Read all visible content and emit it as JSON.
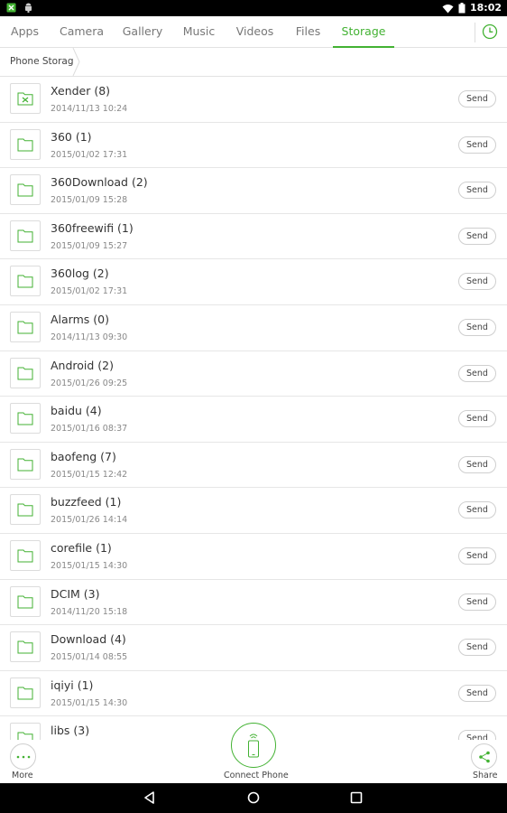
{
  "status_bar": {
    "time": "18:02"
  },
  "tabs": [
    {
      "label": "Apps",
      "active": false
    },
    {
      "label": "Camera",
      "active": false
    },
    {
      "label": "Gallery",
      "active": false
    },
    {
      "label": "Music",
      "active": false
    },
    {
      "label": "Videos",
      "active": false
    },
    {
      "label": "Files",
      "active": false
    },
    {
      "label": "Storage",
      "active": true
    }
  ],
  "breadcrumb": {
    "current": "Phone Storage"
  },
  "files": [
    {
      "name": "Xender (8)",
      "date": "2014/11/13 10:24",
      "icon": "xender-folder-icon"
    },
    {
      "name": "360 (1)",
      "date": "2015/01/02 17:31",
      "icon": "folder-icon"
    },
    {
      "name": "360Download (2)",
      "date": "2015/01/09 15:28",
      "icon": "folder-icon"
    },
    {
      "name": "360freewifi (1)",
      "date": "2015/01/09 15:27",
      "icon": "folder-icon"
    },
    {
      "name": "360log (2)",
      "date": "2015/01/02 17:31",
      "icon": "folder-icon"
    },
    {
      "name": "Alarms (0)",
      "date": "2014/11/13 09:30",
      "icon": "folder-icon"
    },
    {
      "name": "Android (2)",
      "date": "2015/01/26 09:25",
      "icon": "folder-icon"
    },
    {
      "name": "baidu (4)",
      "date": "2015/01/16 08:37",
      "icon": "folder-icon"
    },
    {
      "name": "baofeng (7)",
      "date": "2015/01/15 12:42",
      "icon": "folder-icon"
    },
    {
      "name": "buzzfeed (1)",
      "date": "2015/01/26 14:14",
      "icon": "folder-icon"
    },
    {
      "name": "corefile (1)",
      "date": "2015/01/15 14:30",
      "icon": "folder-icon"
    },
    {
      "name": "DCIM (3)",
      "date": "2014/11/20 15:18",
      "icon": "folder-icon"
    },
    {
      "name": "Download (4)",
      "date": "2015/01/14 08:55",
      "icon": "folder-icon"
    },
    {
      "name": "iqiyi (1)",
      "date": "2015/01/15 14:30",
      "icon": "folder-icon"
    },
    {
      "name": "libs (3)",
      "date": "",
      "icon": "folder-icon"
    }
  ],
  "send_label": "Send",
  "actions": {
    "more_label": "More",
    "connect_label": "Connect Phone",
    "share_label": "Share"
  },
  "colors": {
    "accent": "#43b233",
    "status_bar": "#000000",
    "text": "#333333",
    "muted": "#888888"
  }
}
